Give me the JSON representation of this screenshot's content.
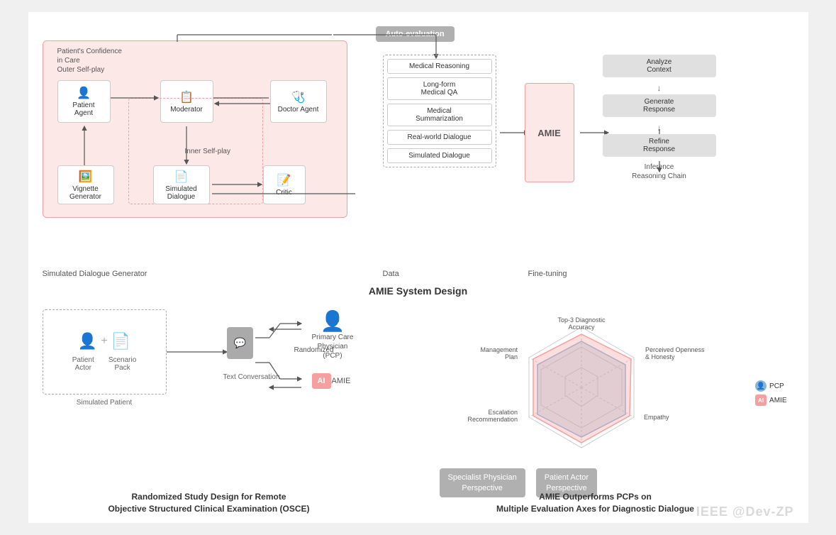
{
  "title": "AMIE System Design",
  "top": {
    "outer_selfplay_label": "Patient's Confidence\nin Care\nOuter Self-play",
    "auto_eval_label": "Auto-evaluation",
    "nodes": {
      "patient_agent": "Patient Agent",
      "moderator": "Moderator",
      "doctor_agent": "Doctor Agent",
      "vignette_generator": "Vignette\nGenerator",
      "simulated_dialogue": "Simulated\nDialogue",
      "critic": "Critic",
      "inner_selfplay": "Inner Self-play"
    },
    "data_items": [
      "Medical Reasoning",
      "Long-form\nMedical QA",
      "Medical\nSummarization",
      "Real-world Dialogue",
      "Simulated Dialogue"
    ],
    "data_label": "Data",
    "amie_label": "AMIE",
    "fine_tuning_label": "Fine-tuning",
    "inference_steps": [
      "Analyze\nContext",
      "Generate\nResponse",
      "Refine\nResponse"
    ],
    "inference_label": "Inference\nReasoning Chain",
    "simulated_dialogue_generator": "Simulated Dialogue Generator"
  },
  "bottom_left": {
    "patient_actor_label": "Patient\nActor",
    "scenario_pack_label": "Scenario\nPack",
    "simulated_patient_label": "Simulated Patient",
    "randomized_label": "Randomized",
    "text_conv_label": "Text Conversation",
    "pcp_label": "Primary Care\nPhysician\n(PCP)",
    "amie_label": "AMIE",
    "ai_badge": "AI",
    "title_line1": "Randomized Study Design for Remote",
    "title_line2": "Objective Structured Clinical Examination (OSCE)"
  },
  "bottom_right": {
    "axes": {
      "top": "Top-3 Diagnostic\nAccuracy",
      "top_right": "Perceived Openness\n& Honesty",
      "right": "Empathy",
      "bottom_right": "Patient Actor\nPerspective",
      "bottom_left": "Specialist Physician\nPerspective",
      "left": "Escalation\nRecommendation",
      "top_left": "Management\nPlan"
    },
    "legend": {
      "pcp_label": "PCP",
      "amie_label": "AMIE"
    },
    "buttons": [
      "Specialist Physician\nPerspective",
      "Patient Actor\nPerspective"
    ],
    "title_line1": "AMIE Outperforms PCPs on",
    "title_line2": "Multiple Evaluation Axes for Diagnostic Dialogue"
  },
  "watermark": "IEEE @Dev-ZP"
}
